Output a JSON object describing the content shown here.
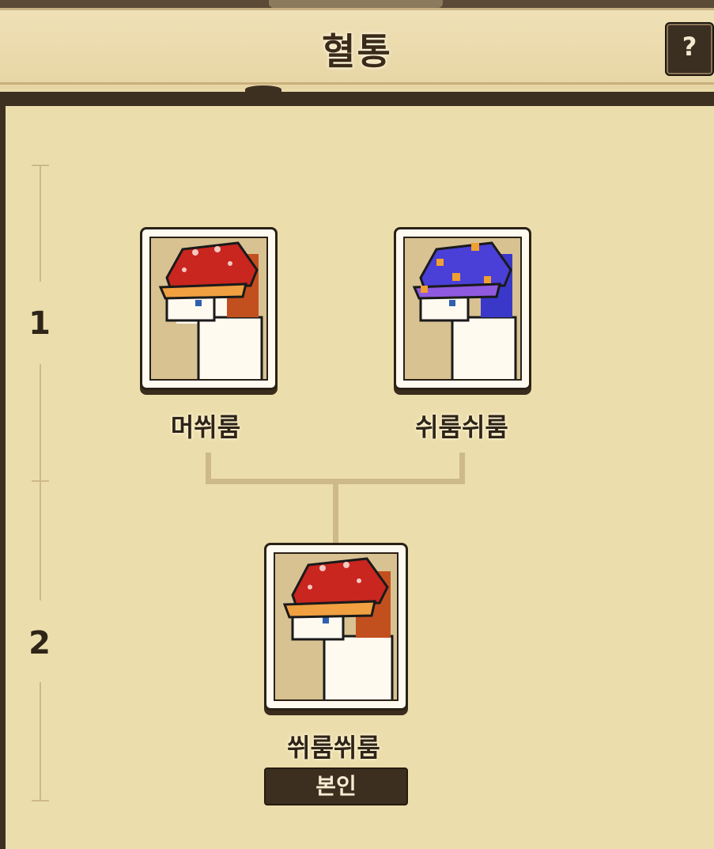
{
  "header": {
    "title": "혈통",
    "help_label": "?"
  },
  "generations": [
    "1",
    "2"
  ],
  "parents": [
    {
      "name": "머쒸룸",
      "hat_color": "#c8261f",
      "hair_color": "#c2501e"
    },
    {
      "name": "쉬룸쉬룸",
      "hat_color": "#4a3fd6",
      "hair_color": "#3a38c8"
    }
  ],
  "self": {
    "name": "쒸룸쒸룸",
    "badge": "본인",
    "hat_color": "#c8261f",
    "hair_color": "#c2501e"
  }
}
